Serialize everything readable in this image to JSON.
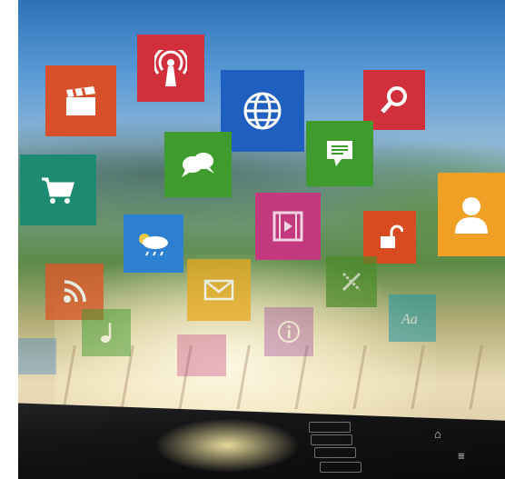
{
  "tiles": [
    {
      "icon": "clapperboard-icon",
      "color": "#d8502b"
    },
    {
      "icon": "broadcast-antenna-icon",
      "color": "#d12f3b"
    },
    {
      "icon": "globe-icon",
      "color": "#1e5fbf"
    },
    {
      "icon": "search-icon",
      "color": "#d12f3b"
    },
    {
      "icon": "chat-bubbles-icon",
      "color": "#3f9b2d"
    },
    {
      "icon": "message-icon",
      "color": "#3f9b2d"
    },
    {
      "icon": "shopping-cart-icon",
      "color": "#1d8a72"
    },
    {
      "icon": "weather-icon",
      "color": "#2d7fd0"
    },
    {
      "icon": "video-icon",
      "color": "#c2397d"
    },
    {
      "icon": "unlock-icon",
      "color": "#d84a1f"
    },
    {
      "icon": "contact-icon",
      "color": "#f0a024"
    },
    {
      "icon": "rss-icon",
      "color": "#dc5a2c"
    },
    {
      "icon": "mail-icon",
      "color": "#e8a91e"
    },
    {
      "icon": "tools-icon",
      "color": "#4c8b2b"
    },
    {
      "icon": "music-icon",
      "color": "#3f9b2d"
    },
    {
      "icon": "info-icon",
      "color": "#9b3a9e"
    },
    {
      "icon": "font-icon",
      "color": "#2d9ba3"
    }
  ]
}
